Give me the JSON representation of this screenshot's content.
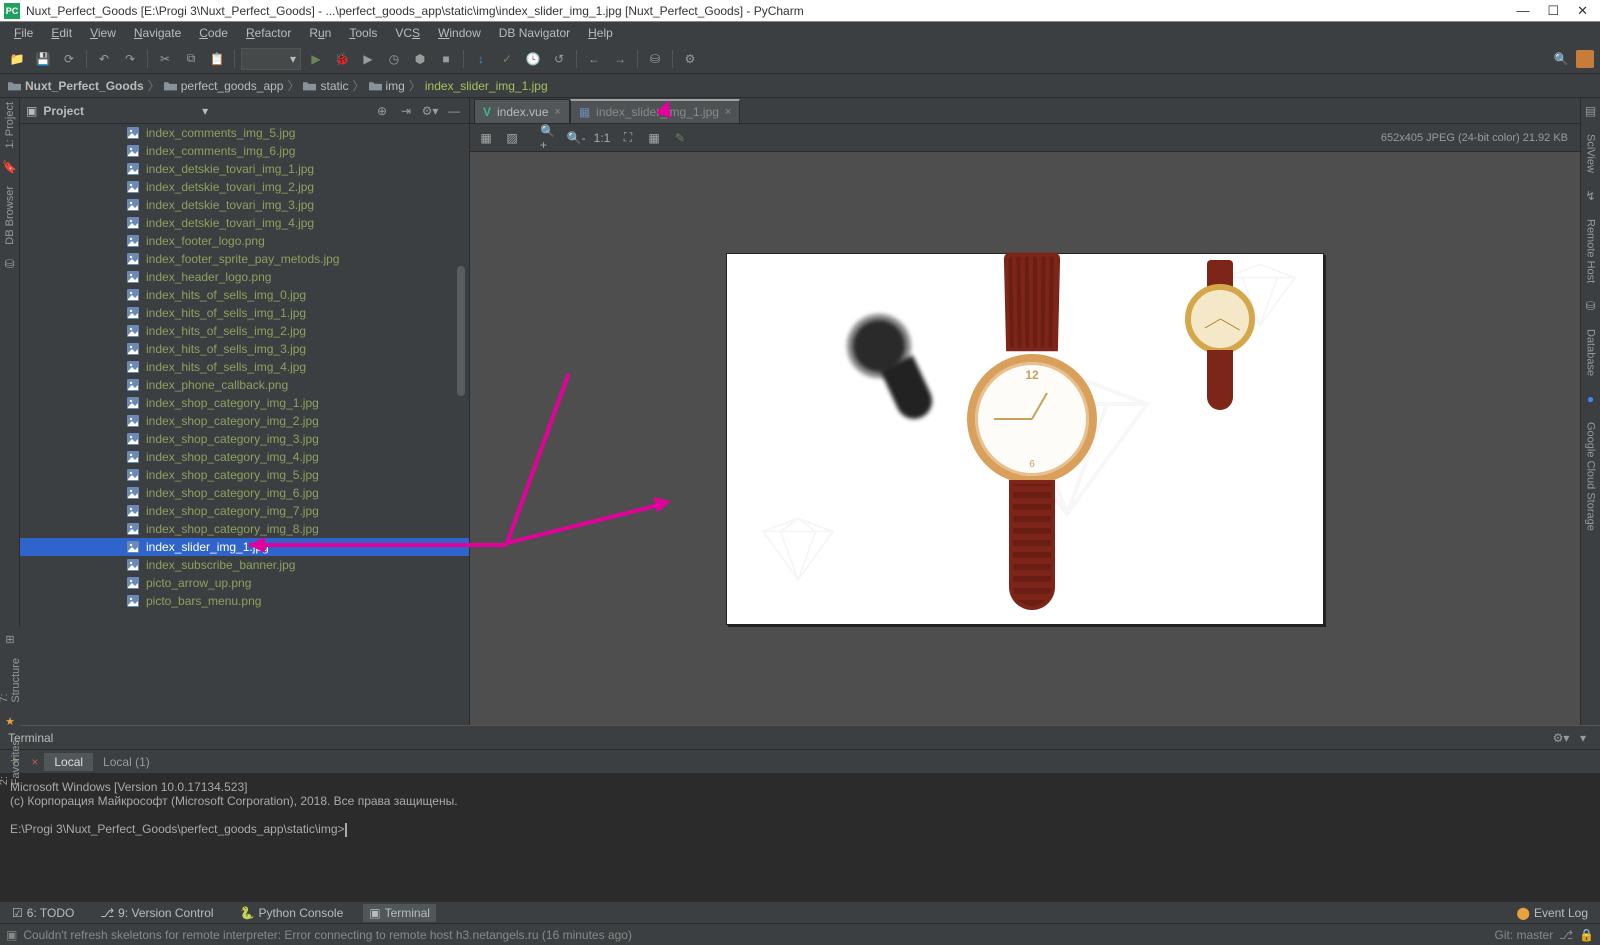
{
  "window": {
    "title": "Nuxt_Perfect_Goods [E:\\Progi 3\\Nuxt_Perfect_Goods] - ...\\perfect_goods_app\\static\\img\\index_slider_img_1.jpg [Nuxt_Perfect_Goods] - PyCharm"
  },
  "menu": {
    "file": "File",
    "edit": "Edit",
    "view": "View",
    "navigate": "Navigate",
    "code": "Code",
    "refactor": "Refactor",
    "run": "Run",
    "tools": "Tools",
    "vcs": "VCS",
    "window": "Window",
    "dbnav": "DB Navigator",
    "help": "Help"
  },
  "breadcrumb": {
    "p0": "Nuxt_Perfect_Goods",
    "p1": "perfect_goods_app",
    "p2": "static",
    "p3": "img",
    "p4": "index_slider_img_1.jpg"
  },
  "project": {
    "title": "Project"
  },
  "tree": {
    "items": [
      "index_comments_img_5.jpg",
      "index_comments_img_6.jpg",
      "index_detskie_tovari_img_1.jpg",
      "index_detskie_tovari_img_2.jpg",
      "index_detskie_tovari_img_3.jpg",
      "index_detskie_tovari_img_4.jpg",
      "index_footer_logo.png",
      "index_footer_sprite_pay_metods.jpg",
      "index_header_logo.png",
      "index_hits_of_sells_img_0.jpg",
      "index_hits_of_sells_img_1.jpg",
      "index_hits_of_sells_img_2.jpg",
      "index_hits_of_sells_img_3.jpg",
      "index_hits_of_sells_img_4.jpg",
      "index_phone_callback.png",
      "index_shop_category_img_1.jpg",
      "index_shop_category_img_2.jpg",
      "index_shop_category_img_3.jpg",
      "index_shop_category_img_4.jpg",
      "index_shop_category_img_5.jpg",
      "index_shop_category_img_6.jpg",
      "index_shop_category_img_7.jpg",
      "index_shop_category_img_8.jpg",
      "index_slider_img_1.jpg",
      "index_subscribe_banner.jpg",
      "picto_arrow_up.png",
      "picto_bars_menu.png"
    ],
    "selected_index": 23
  },
  "tabs": {
    "t0": "index.vue",
    "t1": "index_slider_img_1.jpg"
  },
  "image_info": "652x405 JPEG (24-bit color) 21.92 KB",
  "left_tools": {
    "project": "1: Project",
    "dbbrowser": "DB Browser"
  },
  "right_tools": {
    "scivw": "SciView",
    "remote": "Remote Host",
    "database": "Database",
    "gcloud": "Google Cloud Storage"
  },
  "left_lower_tools": {
    "structure": "7: Structure",
    "favorites": "2: Favorites"
  },
  "terminal": {
    "title": "Terminal",
    "tabs": {
      "local": "Local",
      "local1": "Local (1)"
    },
    "line1": "Microsoft Windows [Version 10.0.17134.523]",
    "line2": "(c) Корпорация Майкрософт (Microsoft Corporation), 2018. Все права защищены.",
    "prompt": "E:\\Progi 3\\Nuxt_Perfect_Goods\\perfect_goods_app\\static\\img>"
  },
  "bottom": {
    "todo": "6: TODO",
    "vcs": "9: Version Control",
    "pyconsole": "Python Console",
    "terminal": "Terminal",
    "eventlog": "Event Log"
  },
  "status": {
    "msg": "Couldn't refresh skeletons for remote interpreter: Error connecting to remote host h3.netangels.ru (16 minutes ago)",
    "git": "Git: master"
  }
}
